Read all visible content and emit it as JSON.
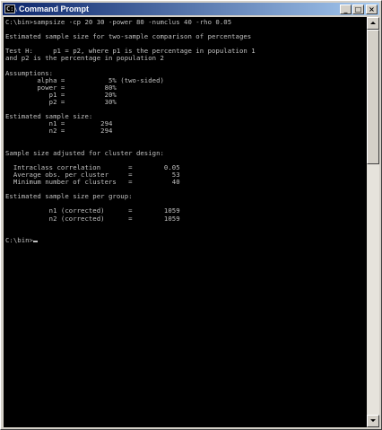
{
  "window": {
    "title": "Command Prompt",
    "icon": "console-icon",
    "icon_glyph": "C:\\",
    "controls": {
      "minimize_glyph": "_",
      "maximize_glyph": "□",
      "close_glyph": "×"
    }
  },
  "console": {
    "text_color": "#c0c0c0",
    "background": "#000000",
    "lines": [
      "C:\\bin>sampsize -cp 20 30 -power 80 -numclus 40 -rho 0.05",
      "",
      "Estimated sample size for two-sample comparison of percentages",
      "",
      "Test H:     p1 = p2, where p1 is the percentage in population 1",
      "and p2 is the percentage in population 2",
      "",
      "Assumptions:",
      "        alpha =           5% (two-sided)",
      "        power =          80%",
      "           p1 =          20%",
      "           p2 =          30%",
      "",
      "Estimated sample size:",
      "           n1 =         294",
      "           n2 =         294",
      "",
      "",
      "Sample size adjusted for cluster design:",
      "",
      "  Intraclass correlation       =        0.05",
      "  Average obs. per cluster     =          53",
      "  Minimum number of clusters   =          40",
      "",
      "Estimated sample size per group:",
      "",
      "           n1 (corrected)      =        1059",
      "           n2 (corrected)      =        1059",
      "",
      "",
      "C:\\bin>"
    ]
  },
  "scrollbar": {
    "position_fraction": 0.0
  }
}
